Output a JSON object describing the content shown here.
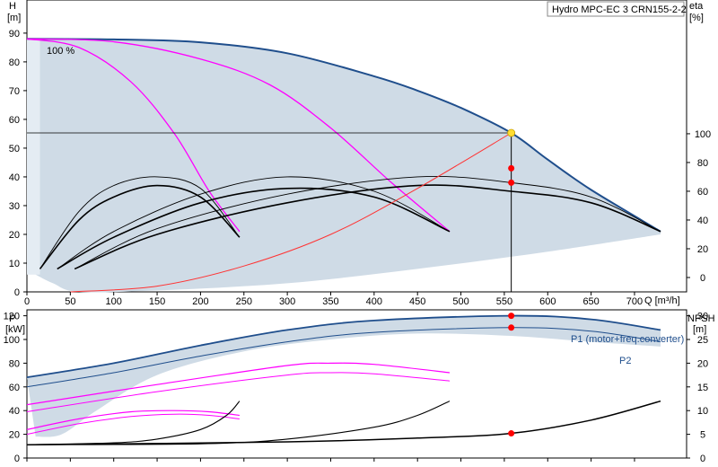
{
  "title": "Hydro MPC-EC 3 CRN155-2-2",
  "colors": {
    "envelope_fill": "#cfdbe6",
    "envelope_fill_light": "#e4ecf3",
    "max_curve": "#1f4e8c",
    "partial_speed": "#ff00ff",
    "system_curve": "#ff3333",
    "efficiency": "#000000",
    "duty_point_marker": "#ffdd33",
    "marker_red": "#ff0000",
    "crosshair": "#000000"
  },
  "chart_data": [
    {
      "type": "line",
      "name_key": "top",
      "title": "Hydro MPC-EC 3 CRN155-2-2",
      "xlabel": "Q [m³/h]",
      "ylabel_left_unit": "H",
      "ylabel_left_bracket": "[m]",
      "ylabel_right_unit": "eta",
      "ylabel_right_bracket": "[%]",
      "xlim": [
        0,
        760
      ],
      "ylim_left": [
        0,
        100
      ],
      "ylim_right_mapping": {
        "eta_per_H": 2,
        "offset_H": 5
      },
      "x_ticks": [
        0,
        50,
        100,
        150,
        200,
        250,
        300,
        350,
        400,
        450,
        500,
        550,
        600,
        650,
        700
      ],
      "y_ticks_left": [
        0,
        10,
        20,
        30,
        40,
        50,
        60,
        70,
        80,
        90
      ],
      "y_ticks_right": [
        0,
        20,
        40,
        60,
        80,
        100
      ],
      "annotation_100pct": "100 %",
      "duty_point": {
        "Q": 558,
        "H": 55.3
      },
      "eta_markers": [
        {
          "Q": 558,
          "eta": 66
        },
        {
          "Q": 558,
          "eta": 76
        }
      ],
      "max_curve": {
        "Q": [
          0,
          100,
          200,
          300,
          400,
          450,
          500,
          558,
          600,
          650,
          730
        ],
        "H": [
          88,
          87.8,
          86.8,
          83,
          75,
          70,
          64,
          55.3,
          46,
          35.5,
          21
        ]
      },
      "min_envelope_bottom": {
        "Q": [
          10,
          30,
          60,
          150,
          300,
          450,
          600,
          730
        ],
        "H": [
          6,
          3,
          0,
          0.5,
          3,
          8,
          14,
          20
        ]
      },
      "partial_speed_1": {
        "Q": [
          0,
          60,
          120,
          170,
          210,
          245
        ],
        "H": [
          88,
          85,
          73,
          55,
          35,
          21
        ]
      },
      "partial_speed_2": {
        "Q": [
          0,
          100,
          200,
          280,
          350,
          420,
          487
        ],
        "H": [
          88,
          87,
          81,
          72,
          57,
          38,
          21
        ]
      },
      "system_curve": {
        "Q": [
          50,
          150,
          250,
          350,
          450,
          558
        ],
        "H": [
          0,
          2,
          9,
          20,
          36,
          55.3
        ]
      },
      "eta_family": [
        {
          "Q": [
            15,
            60,
            100,
            150,
            200,
            245
          ],
          "eta": [
            6,
            46,
            64,
            70,
            62,
            28
          ]
        },
        {
          "Q": [
            15,
            60,
            100,
            150,
            200,
            245
          ],
          "eta": [
            6,
            40,
            56,
            64,
            56,
            28
          ]
        },
        {
          "Q": [
            35,
            100,
            200,
            300,
            400,
            487
          ],
          "eta": [
            6,
            32,
            58,
            70,
            60,
            32
          ]
        },
        {
          "Q": [
            35,
            100,
            200,
            300,
            400,
            487
          ],
          "eta": [
            6,
            28,
            52,
            62,
            56,
            32
          ]
        },
        {
          "Q": [
            55,
            150,
            300,
            450,
            558,
            650,
            730
          ],
          "eta": [
            6,
            34,
            58,
            70,
            66,
            56,
            32
          ]
        },
        {
          "Q": [
            55,
            150,
            300,
            450,
            558,
            650,
            730
          ],
          "eta": [
            6,
            30,
            52,
            64,
            60,
            52,
            32
          ]
        }
      ]
    },
    {
      "type": "line",
      "name_key": "bottom",
      "xlabel": "",
      "ylabel_left_unit": "P",
      "ylabel_left_bracket": "[kW]",
      "ylabel_right_unit": "NPSH",
      "ylabel_right_bracket": "[m]",
      "xlim": [
        0,
        760
      ],
      "ylim_left": [
        0,
        125
      ],
      "ylim_right": [
        0,
        31.25
      ],
      "y_ticks_left": [
        0,
        20,
        40,
        60,
        80,
        100,
        120
      ],
      "y_ticks_right": [
        0,
        5,
        10,
        15,
        20,
        25,
        30
      ],
      "series_label_p1": "P1 (motor+freq.converter)",
      "series_label_p2": "P2",
      "markers": [
        {
          "Q": 558,
          "P": 120
        },
        {
          "Q": 558,
          "P": 110
        },
        {
          "Q": 558,
          "NPSH": 5.2
        }
      ],
      "p1": {
        "Q": [
          0,
          100,
          200,
          300,
          400,
          558,
          650,
          730
        ],
        "P": [
          68,
          80,
          95,
          108,
          116,
          120,
          117,
          108
        ]
      },
      "p2": {
        "Q": [
          0,
          100,
          200,
          300,
          400,
          558,
          650,
          730
        ],
        "P": [
          60,
          72,
          86,
          98,
          106,
          110,
          107,
          98
        ]
      },
      "partial_p1": {
        "Q": [
          0,
          150,
          300,
          350,
          400,
          487
        ],
        "P": [
          45,
          62,
          78,
          80,
          79,
          72
        ]
      },
      "partial_p2": {
        "Q": [
          0,
          150,
          300,
          350,
          400,
          487
        ],
        "P": [
          39,
          56,
          70,
          72,
          71,
          65
        ]
      },
      "small_p1": {
        "Q": [
          0,
          60,
          120,
          170,
          210,
          245
        ],
        "P": [
          24,
          33,
          39,
          40,
          39,
          36
        ]
      },
      "small_p2": {
        "Q": [
          0,
          60,
          120,
          170,
          210,
          245
        ],
        "P": [
          20,
          29,
          35,
          37,
          36,
          33
        ]
      },
      "npsh_1": {
        "Q": [
          0,
          100,
          150,
          200,
          230,
          245
        ],
        "NPSH": [
          2.8,
          3.2,
          4,
          6,
          9,
          12
        ]
      },
      "npsh_2": {
        "Q": [
          0,
          200,
          300,
          400,
          450,
          487
        ],
        "NPSH": [
          2.8,
          3,
          4,
          6.5,
          9,
          12
        ]
      },
      "npsh_3": {
        "Q": [
          0,
          300,
          450,
          558,
          650,
          730
        ],
        "NPSH": [
          2.8,
          3.4,
          4.2,
          5.2,
          8,
          12
        ]
      },
      "envelope_upper": {
        "Q": [
          0,
          100,
          200,
          300,
          400,
          558,
          650,
          730
        ],
        "P": [
          68,
          80,
          95,
          108,
          116,
          120,
          117,
          108
        ]
      },
      "envelope_lower": {
        "Q": [
          10,
          40,
          80,
          150,
          250,
          350,
          450,
          558,
          650,
          730
        ],
        "P": [
          18,
          20,
          40,
          70,
          90,
          100,
          105,
          103,
          98,
          94
        ]
      }
    }
  ]
}
